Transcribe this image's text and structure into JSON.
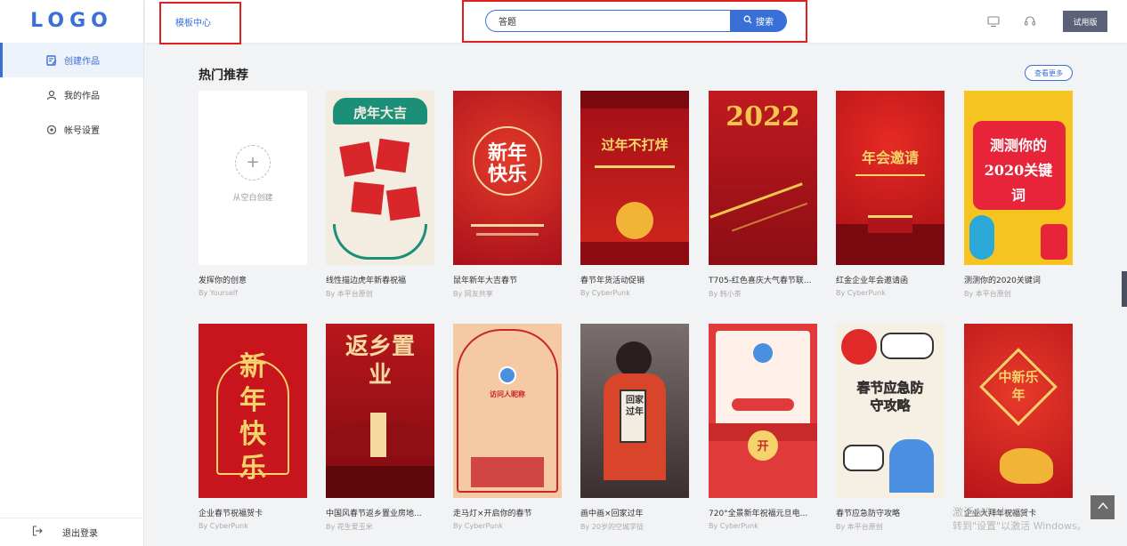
{
  "logo": "LOGO",
  "sidebar": {
    "items": [
      {
        "label": "创建作品",
        "icon": "edit-icon",
        "active": true
      },
      {
        "label": "我的作品",
        "icon": "user-icon",
        "active": false
      },
      {
        "label": "帐号设置",
        "icon": "settings-icon",
        "active": false
      }
    ],
    "logout_label": "退出登录"
  },
  "header": {
    "breadcrumb": "模板中心",
    "search_value": "答题",
    "search_button": "搜索",
    "trial_label": "试用版"
  },
  "main": {
    "section_title": "热门推荐",
    "see_more": "查看更多",
    "blank_card": {
      "label": "从空白创建",
      "title": "发挥你的创意",
      "author": "By Yourself"
    },
    "row1": [
      {
        "title": "线性描边虎年新春祝福",
        "author": "By 本平台原创",
        "poster": "虎年大吉",
        "bg": "#f3ece1",
        "fg": "#d8262a"
      },
      {
        "title": "鼠年新年大吉春节",
        "author": "By 网友共享",
        "poster": "新年快乐",
        "bg": "#c8171e",
        "fg": "#ffffff"
      },
      {
        "title": "春节年货活动促销",
        "author": "By CyberPunk",
        "poster": "过年不打烊",
        "bg": "#b4121a",
        "fg": "#f8d86b"
      },
      {
        "title": "T705-红色喜庆大气春节联...",
        "author": "By 韩小茶",
        "poster": "2022",
        "bg": "#b0141b",
        "fg": "#f2c74c"
      },
      {
        "title": "红金企业年会邀请函",
        "author": "By CyberPunk",
        "poster": "年会邀请",
        "bg": "#c8141c",
        "fg": "#f6d36a"
      },
      {
        "title": "测测你的2020关键词",
        "author": "By 本平台原创",
        "poster": "测测你的2020关键词",
        "bg": "#f5c420",
        "fg": "#ffffff"
      }
    ],
    "row2": [
      {
        "title": "企业春节祝福贺卡",
        "author": "By CyberPunk",
        "poster": "新年快乐",
        "bg": "#c8141c",
        "fg": "#f6d36a"
      },
      {
        "title": "中国风春节返乡置业房地...",
        "author": "By 花生爱玉米",
        "poster": "返乡置业",
        "bg": "#b7171c",
        "fg": "#f6d9a0"
      },
      {
        "title": "走马灯×开启你的春节",
        "author": "By CyberPunk",
        "poster": "访问人昵称",
        "bg": "#f4c9a4",
        "fg": "#c8262a"
      },
      {
        "title": "画中画×回家过年",
        "author": "By 20岁的空城学徒",
        "poster": "回家过年",
        "bg": "#5b4b4a",
        "fg": "#ffffff"
      },
      {
        "title": "720°全景新年祝福元旦电...",
        "author": "By CyberPunk",
        "poster": "开",
        "bg": "#e03a3a",
        "fg": "#f6d36a"
      },
      {
        "title": "春节应急防守攻略",
        "author": "By 本平台原创",
        "poster": "春节应急防守攻略",
        "bg": "#f6efe3",
        "fg": "#e02a2a"
      },
      {
        "title": "企业大拜年祝福贺卡",
        "author": "",
        "poster": "中新乐年",
        "bg": "#d71d1d",
        "fg": "#f6d36a"
      }
    ]
  },
  "watermark": {
    "line1": "激活 Windows",
    "line2": "转到\"设置\"以激活 Windows。"
  },
  "colors": {
    "accent": "#3a6fd8",
    "highlight": "#e02020"
  }
}
